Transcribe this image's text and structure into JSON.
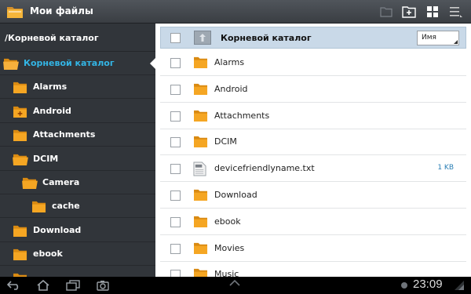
{
  "app": {
    "title": "Мои файлы"
  },
  "left_pane": {
    "path": "/Корневой каталог",
    "items": [
      {
        "label": "Корневой каталог",
        "level": 0,
        "active": true,
        "icon": "folder-open-icon"
      },
      {
        "label": "Alarms",
        "level": 1,
        "icon": "folder-icon"
      },
      {
        "label": "Android",
        "level": 1,
        "icon": "folder-plus-icon"
      },
      {
        "label": "Attachments",
        "level": 1,
        "icon": "folder-icon"
      },
      {
        "label": "DCIM",
        "level": 1,
        "icon": "folder-open-icon"
      },
      {
        "label": "Camera",
        "level": 2,
        "icon": "folder-open-icon"
      },
      {
        "label": "cache",
        "level": 3,
        "icon": "folder-icon"
      },
      {
        "label": "Download",
        "level": 1,
        "icon": "folder-icon"
      },
      {
        "label": "ebook",
        "level": 1,
        "icon": "folder-icon"
      },
      {
        "label": "",
        "level": 1,
        "icon": "folder-icon"
      }
    ]
  },
  "right_pane": {
    "header": {
      "title": "Корневой каталог",
      "sort_label": "Имя"
    },
    "rows": [
      {
        "name": "Alarms",
        "type": "folder",
        "size": ""
      },
      {
        "name": "Android",
        "type": "folder",
        "size": ""
      },
      {
        "name": "Attachments",
        "type": "folder",
        "size": ""
      },
      {
        "name": "DCIM",
        "type": "folder",
        "size": ""
      },
      {
        "name": "devicefriendlyname.txt",
        "type": "txt",
        "size": "1 KB"
      },
      {
        "name": "Download",
        "type": "folder",
        "size": ""
      },
      {
        "name": "ebook",
        "type": "folder",
        "size": ""
      },
      {
        "name": "Movies",
        "type": "folder",
        "size": ""
      },
      {
        "name": "Music",
        "type": "folder",
        "size": ""
      }
    ]
  },
  "system_bar": {
    "time": "23:09"
  },
  "colors": {
    "accent": "#33b5e5",
    "folder": "#f5a623",
    "header_row": "#c9d9e8",
    "size_text": "#2a7fb5"
  }
}
